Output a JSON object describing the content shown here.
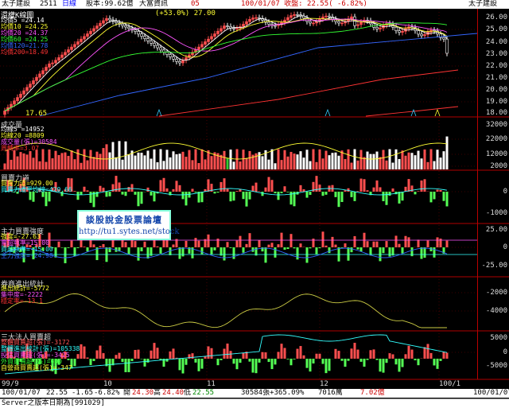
{
  "header": {
    "name": "太子建設",
    "code": "2511",
    "period": "日線",
    "capital": "股本:99.62億",
    "source": "大富資訊",
    "fav": "05",
    "right_name": "太子建設"
  },
  "main_panel": {
    "title": "還權K線圖",
    "ma_labels": [
      {
        "text": "均價5  =24.14",
        "color": "#ffffff"
      },
      {
        "text": "均價10 =24.25",
        "color": "#ffff33"
      },
      {
        "text": "均價20 =24.37",
        "color": "#ff55ff"
      },
      {
        "text": "均價60 =24.25",
        "color": "#33ff33"
      },
      {
        "text": "均價120=21.78",
        "color": "#3366ff"
      },
      {
        "text": "均價200=18.49",
        "color": "#ff3333"
      }
    ],
    "info": "100/01/07  收盤: 22.55( -6.82%)",
    "high_note": "(+53.0%) 27.00",
    "low_note": "17.65",
    "yticks": [
      "26.00",
      "25.00",
      "24.00",
      "23.00",
      "22.00",
      "21.00",
      "20.00",
      "19.00",
      "18.00"
    ]
  },
  "volume_panel": {
    "title": "成交量",
    "labels": [
      {
        "text": "均線5  =14952",
        "color": "#ffffff"
      },
      {
        "text": "均線20 =8809",
        "color": "#ffff33"
      },
      {
        "text": "成交量(張)=30584",
        "color": "#ff55ff"
      },
      {
        "text": "周轉率=3.07",
        "color": "#ff3333"
      }
    ],
    "yticks": [
      "32000",
      "22000",
      "12000",
      "2000"
    ]
  },
  "power_panel": {
    "title": "買賣力道",
    "labels": [
      {
        "text": "買賣力道=929.00",
        "color": "#ffff33"
      },
      {
        "text": "買賣力道平均線=420.66",
        "color": "#33ffff"
      }
    ],
    "yticks": [
      "0",
      "-1000"
    ]
  },
  "main_force_panel": {
    "title": "主力買賣強度",
    "labels": [
      {
        "text": "強度=-27.63",
        "color": "#ffff33"
      },
      {
        "text": "賣超執準=15.00",
        "color": "#ff55ff"
      },
      {
        "text": "買超執準=-15.00",
        "color": "#33ffff"
      },
      {
        "text": "主力強度=-24.98",
        "color": "#3366ff"
      }
    ],
    "yticks": [
      "25.00",
      "0",
      "-25.00"
    ]
  },
  "broker_panel": {
    "title": "券商進出統計",
    "labels": [
      {
        "text": "進出統計=-5772",
        "color": "#ffff33"
      },
      {
        "text": "集中度=-2222",
        "color": "#ff55ff"
      },
      {
        "text": "穩定率=-13.1",
        "color": "#ff3333"
      }
    ],
    "yticks": [
      "-2000",
      "-4000"
    ]
  },
  "inst_panel": {
    "title": "三大法人買賣超",
    "labels": [
      {
        "text": "整體買賣超(張)=-3172",
        "color": "#ff5555"
      },
      {
        "text": "整體進出統計(張)=105338",
        "color": "#33ffff"
      },
      {
        "text": "投信買賣超(張)=-3425",
        "color": "#ff55ff"
      },
      {
        "text": "外資買賣超(張)=600",
        "color": "#33ff33"
      },
      {
        "text": "自營商買賣超(張)=-347",
        "color": "#ffff33"
      }
    ],
    "yticks": [
      "5000",
      "0",
      "-5000"
    ]
  },
  "ad_banner": {
    "line1": "談股說金股票論壇",
    "line2": "http://tu1.sytes.net/stock"
  },
  "x_labels": [
    {
      "text": "99/9",
      "x": 2
    },
    {
      "text": "10",
      "x": 130
    },
    {
      "text": "11",
      "x": 260
    },
    {
      "text": "12",
      "x": 402
    },
    {
      "text": "100/1",
      "x": 552
    }
  ],
  "status": {
    "date": "100/01/07",
    "close": "22.55",
    "change": "-1.65",
    "pct": "-6.82%",
    "open_lbl": "開",
    "open": "24.30",
    "high_lbl": "高",
    "high": "24.40",
    "low_lbl": "低",
    "low": "22.55",
    "volume": "30584張+365.09%",
    "amount": "7016萬",
    "turnover": "7.02億",
    "right_date": "100/01/07"
  },
  "footer": {
    "text": "Server之版本日期為[991029]"
  },
  "colors": {
    "up": "#ff4f4f",
    "down": "#55ff55",
    "grid": "#b00000"
  }
}
